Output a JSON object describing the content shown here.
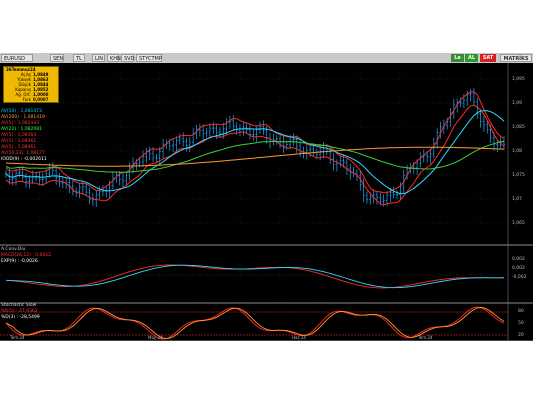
{
  "toolbar": {
    "symbol": "EURUSD",
    "buttons": [
      "SEN",
      "TL",
      "LIN",
      "KHN",
      "SVD",
      "STYCTMP"
    ],
    "right_buttons": [
      "Le",
      "AL",
      "SAT"
    ],
    "brand": "MATRİKS"
  },
  "infobox": {
    "title": "26Temmuz24",
    "rows": [
      {
        "k": "Açılış",
        "v": "1,0849"
      },
      {
        "k": "Yüksek",
        "v": "1,0863"
      },
      {
        "k": "Düşük",
        "v": "1,0844"
      },
      {
        "k": "Kapanış",
        "v": "1,0852"
      },
      {
        "k": "Ağ. Ort.",
        "v": "1,0000"
      },
      {
        "k": "Fark",
        "v": "0,0007"
      }
    ]
  },
  "indicators": [
    {
      "label": "AV(50)  : 1,081473",
      "color": "#00d0ff"
    },
    {
      "label": "AV(200) : 1,081419",
      "color": "#ff9933"
    },
    {
      "label": "AV(5)   : 1,082443",
      "color": "#ff3333"
    },
    {
      "label": "AV(22)  : 1,082081",
      "color": "#33ff33"
    },
    {
      "label": "AV(5)   : 1,08364",
      "color": "#ff3333"
    },
    {
      "label": "AV(5)   : 1,08361",
      "color": "#ff3333"
    },
    {
      "label": "AV(5)   : 1,08461",
      "color": "#ff3333"
    },
    {
      "label": "AV(50,23): 1,08177",
      "color": "#ff3333"
    },
    {
      "label": "IOOD(9) : -0,002611",
      "color": "#ffffff"
    }
  ],
  "price_axis": [
    "1,095",
    "1,09",
    "1,085",
    "1,08",
    "1,075",
    "1,07",
    "1,065"
  ],
  "macd_panel": {
    "title": "A.Conv.Div.",
    "lines": [
      {
        "label": "MACD(26,12) : 0,0022",
        "color": "#ff3333"
      },
      {
        "label": "EXP(9)      : -0,0026",
        "color": "#ffffff"
      }
    ],
    "axis": [
      "0,002",
      "0,002",
      "-0,002"
    ]
  },
  "stoch_panel": {
    "title": "Stochastic Slow",
    "lines": [
      {
        "label": "%K(5)  : 27,9362",
        "color": "#ff3333"
      },
      {
        "label": "%D(3)  : -28,5499",
        "color": "#ffffff"
      }
    ],
    "axis": [
      "80",
      "50",
      "20"
    ]
  },
  "date_axis": [
    "Tem 24",
    "May 24",
    "Haz 24",
    "Tem 24"
  ],
  "colors": {
    "candle": "#1eaaff",
    "ma_red": "#ff2a2a",
    "ma_cyan": "#2fd6ff",
    "ma_green": "#3ad13a",
    "ma_orange": "#ff9a2e",
    "level_line": "#ff3030"
  }
}
